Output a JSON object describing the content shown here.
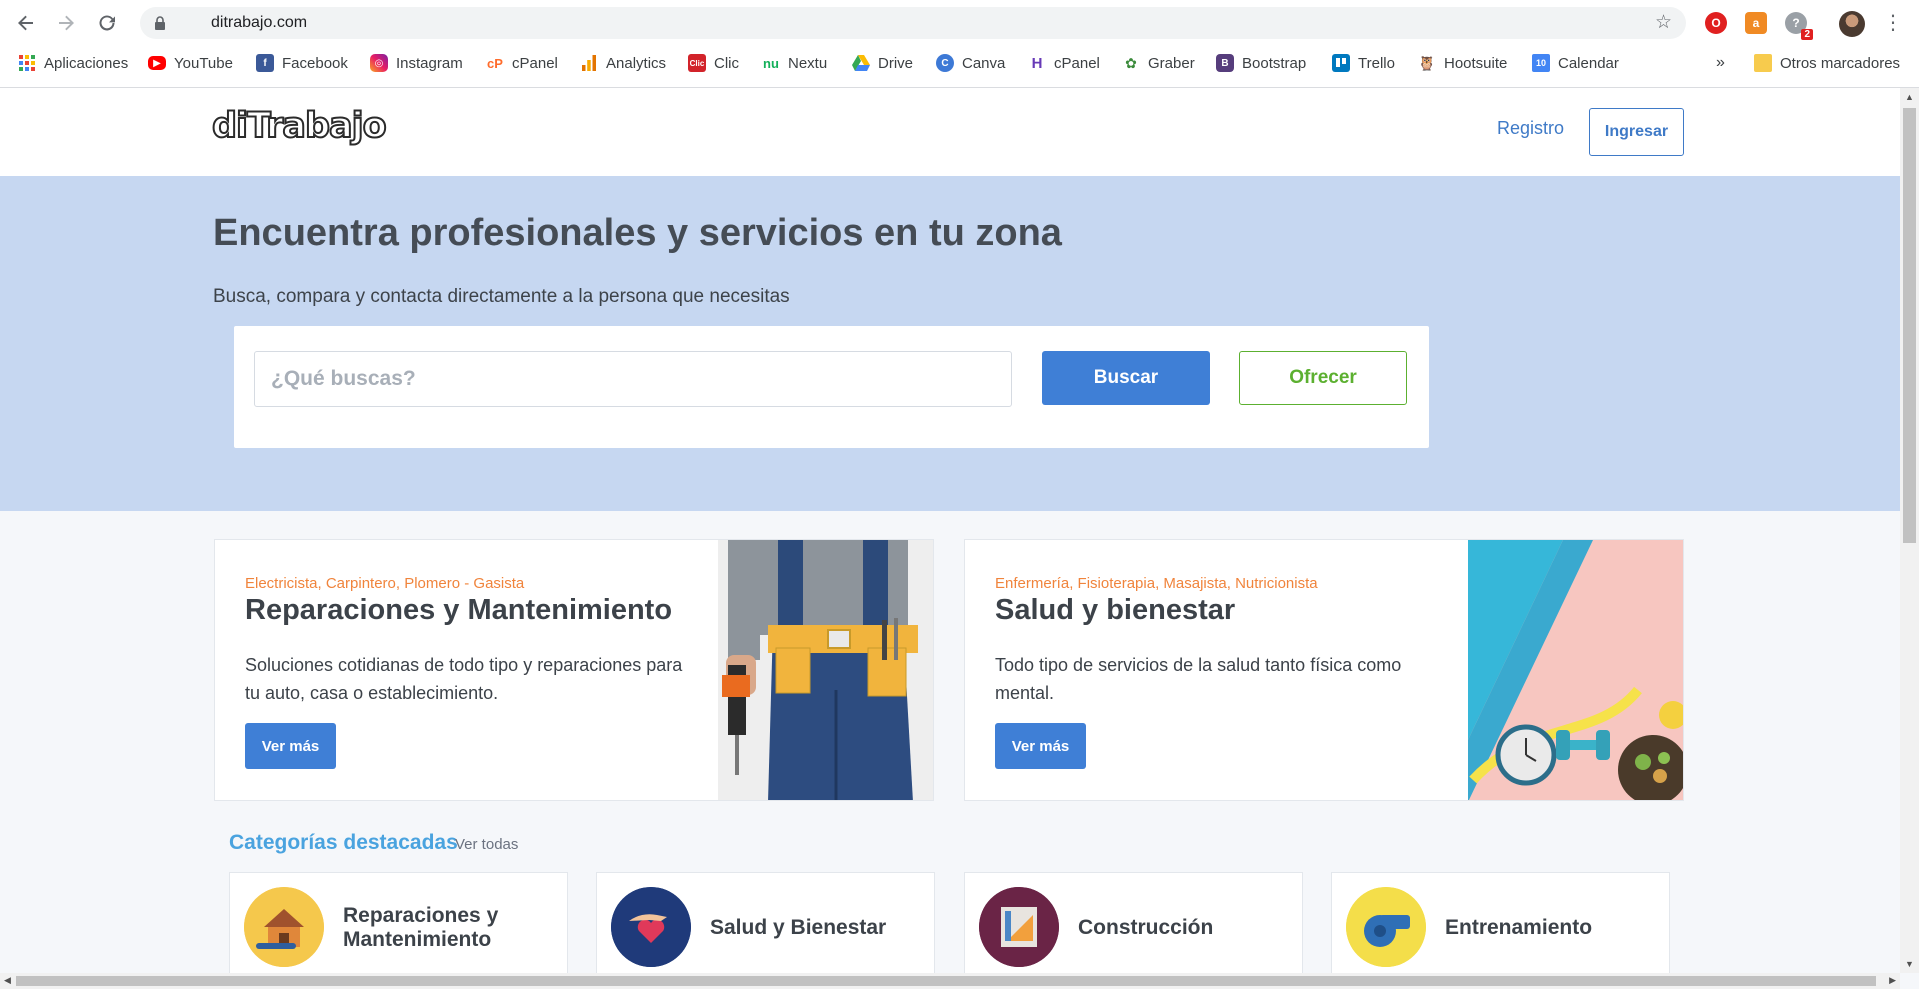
{
  "browser": {
    "url": "ditrabajo.com",
    "bookmarks": [
      {
        "label": "Aplicaciones",
        "icon": "apps-grid-icon"
      },
      {
        "label": "YouTube",
        "icon": "youtube-icon"
      },
      {
        "label": "Facebook",
        "icon": "facebook-icon"
      },
      {
        "label": "Instagram",
        "icon": "instagram-icon"
      },
      {
        "label": "cPanel",
        "icon": "cpanel-icon"
      },
      {
        "label": "Analytics",
        "icon": "analytics-icon"
      },
      {
        "label": "Clic",
        "icon": "clic-icon"
      },
      {
        "label": "Nextu",
        "icon": "nextu-icon"
      },
      {
        "label": "Drive",
        "icon": "drive-icon"
      },
      {
        "label": "Canva",
        "icon": "canva-icon"
      },
      {
        "label": "cPanel",
        "icon": "cpanel-h-icon"
      },
      {
        "label": "Graber",
        "icon": "graber-icon"
      },
      {
        "label": "Bootstrap",
        "icon": "bootstrap-icon"
      },
      {
        "label": "Trello",
        "icon": "trello-icon"
      },
      {
        "label": "Hootsuite",
        "icon": "hootsuite-icon"
      },
      {
        "label": "Calendar",
        "icon": "calendar-icon"
      }
    ],
    "overflow": "»",
    "other_bookmarks": "Otros marcadores",
    "extension_badge": "2"
  },
  "site": {
    "logo": "diTrabajo",
    "nav": {
      "registro": "Registro",
      "ingresar": "Ingresar"
    }
  },
  "hero": {
    "title": "Encuentra profesionales y servicios en tu zona",
    "subtitle": "Busca, compara y contacta directamente a la persona que necesitas",
    "search_placeholder": "¿Qué buscas?",
    "search_button": "Buscar",
    "offer_button": "Ofrecer"
  },
  "cards": [
    {
      "tags": "Electricista, Carpintero, Plomero - Gasista",
      "title": "Reparaciones y Mantenimiento",
      "description": "Soluciones cotidianas de todo tipo y reparaciones para tu auto, casa o establecimiento.",
      "button": "Ver más"
    },
    {
      "tags": "Enfermería, Fisioterapia, Masajista, Nutricionista",
      "title": "Salud y bienestar",
      "description": "Todo tipo de servicios de la salud tanto física como mental.",
      "button": "Ver más"
    }
  ],
  "categories": {
    "title": "Categorías destacadas",
    "see_all": "Ver todas",
    "items": [
      {
        "label": "Reparaciones y Mantenimiento",
        "color": "#f5c84c"
      },
      {
        "label": "Salud y Bienestar",
        "color": "#1f3a7a"
      },
      {
        "label": "Construcción",
        "color": "#6a2446"
      },
      {
        "label": "Entrenamiento",
        "color": "#f4de4a"
      }
    ]
  },
  "colors": {
    "primary": "#3f7fd6",
    "accent_green": "#5cb030",
    "tag_orange": "#f0843c",
    "hero_bg": "#c6d7f1"
  }
}
